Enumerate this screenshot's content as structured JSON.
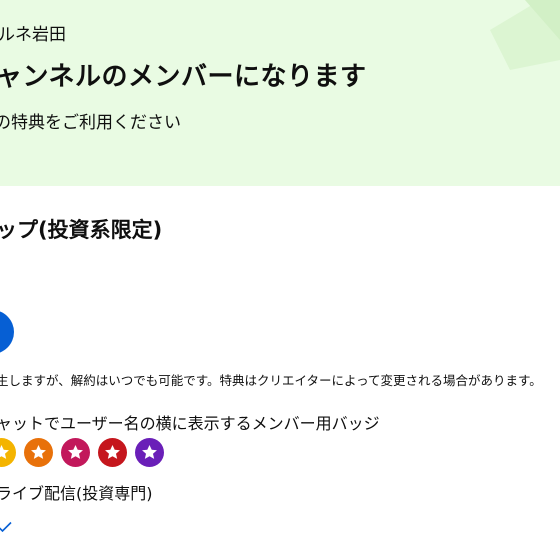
{
  "header": {
    "channel_name": "ルネ岩田",
    "headline": "ャンネルのメンバーになります",
    "subheadline": "の特典をご利用ください",
    "background_color": "#e9fbe3"
  },
  "tier": {
    "title": "ップ(投資系限定)",
    "join_button_color": "#065fd4",
    "notice": "生しますが、解約はいつでも可能です。特典はクリエイターによって変更される場合があります。"
  },
  "perks": {
    "badge_perk": "ャットでユーザー名の横に表示するメンバー用バッジ",
    "badges": [
      {
        "icon": "star-badge-icon",
        "color": "#f4b400"
      },
      {
        "icon": "star-badge-icon",
        "color": "#e8710a"
      },
      {
        "icon": "star-badge-icon",
        "color": "#c2185b"
      },
      {
        "icon": "star-badge-icon",
        "color": "#c5161d"
      },
      {
        "icon": "star-badge-icon",
        "color": "#6a1fb8"
      }
    ],
    "live_perk": "ライブ配信(投資専門)",
    "check_icon": "check-icon"
  }
}
